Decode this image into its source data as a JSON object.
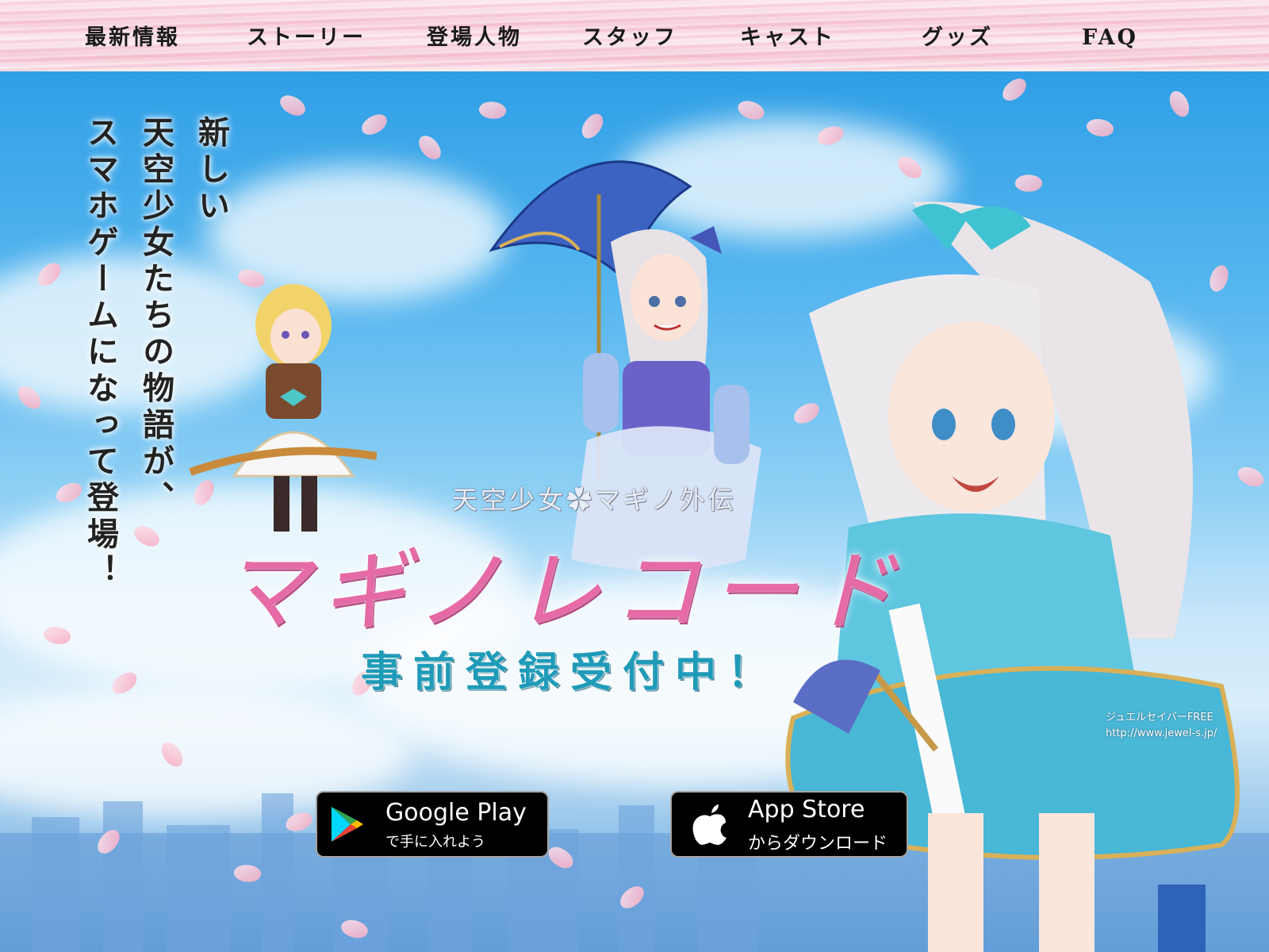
{
  "nav": {
    "items": [
      {
        "label": "最新情報"
      },
      {
        "label": "ストーリー"
      },
      {
        "label": "登場人物"
      },
      {
        "label": "スタッフ"
      },
      {
        "label": "キャスト"
      },
      {
        "label": "グッズ"
      },
      {
        "label": "FAQ"
      }
    ]
  },
  "hero": {
    "tagline": [
      "新しい",
      "天空少女たちの物語が、",
      "スマホゲームになって登場！"
    ],
    "subtitle": "天空少女✿マギノ外伝",
    "title": "マギノレコード",
    "preregistration": "事前登録受付中！",
    "google_play": {
      "main": "Google Play",
      "sub": "で手に入れよう"
    },
    "app_store": {
      "main": "App Store",
      "sub": "からダウンロード"
    },
    "credit": [
      "ジュエルセイバーFREE",
      "http://www.jewel-s.jp/"
    ]
  },
  "colors": {
    "nav_bg": "#f6c9d6",
    "sky": "#56b6ef",
    "logo_pink": "#e66aa6",
    "prereg_teal": "#1f9bb8",
    "button_black": "#000000"
  }
}
